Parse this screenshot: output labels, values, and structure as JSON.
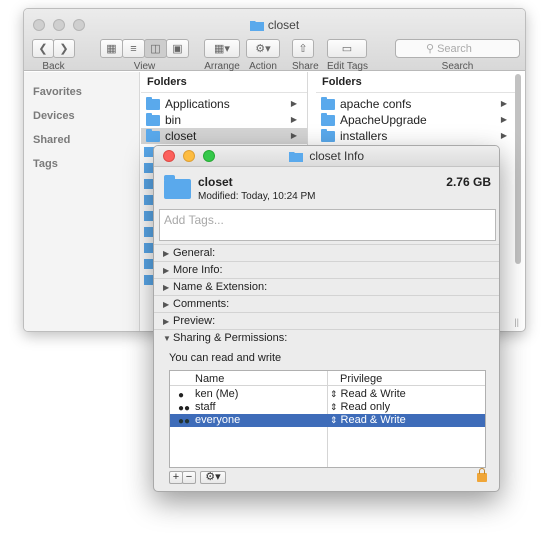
{
  "finder": {
    "title": "closet",
    "toolbar": {
      "back_label": "Back",
      "view_label": "View",
      "arrange_label": "Arrange",
      "action_label": "Action",
      "share_label": "Share",
      "edit_tags_label": "Edit Tags",
      "search_placeholder": "Search",
      "search_label": "Search"
    },
    "sidebar": [
      "Favorites",
      "Devices",
      "Shared",
      "Tags"
    ],
    "col1": {
      "header": "Folders",
      "items": [
        "Applications",
        "bin",
        "closet"
      ],
      "selected": "closet"
    },
    "col2": {
      "header": "Folders",
      "items": [
        "apache confs",
        "ApacheUpgrade",
        "installers"
      ]
    }
  },
  "info": {
    "title": "closet Info",
    "name": "closet",
    "size": "2.76 GB",
    "modified": "Modified: Today, 10:24 PM",
    "tags_placeholder": "Add Tags...",
    "sections": [
      "General:",
      "More Info:",
      "Name & Extension:",
      "Comments:",
      "Preview:"
    ],
    "sharing_section": "Sharing & Permissions:",
    "permission_note": "You can read and write",
    "table": {
      "col_name": "Name",
      "col_privilege": "Privilege",
      "rows": [
        {
          "name": "ken (Me)",
          "privilege": "Read & Write"
        },
        {
          "name": "staff",
          "privilege": "Read only"
        },
        {
          "name": "everyone",
          "privilege": "Read & Write"
        }
      ],
      "selected_row": "everyone"
    },
    "bottom": {
      "add": "+",
      "remove": "−",
      "action": "⚙▾"
    },
    "colors": {
      "selection": "#3e6cb9",
      "folder": "#5aa9ec",
      "lock": "#f0a638"
    }
  }
}
